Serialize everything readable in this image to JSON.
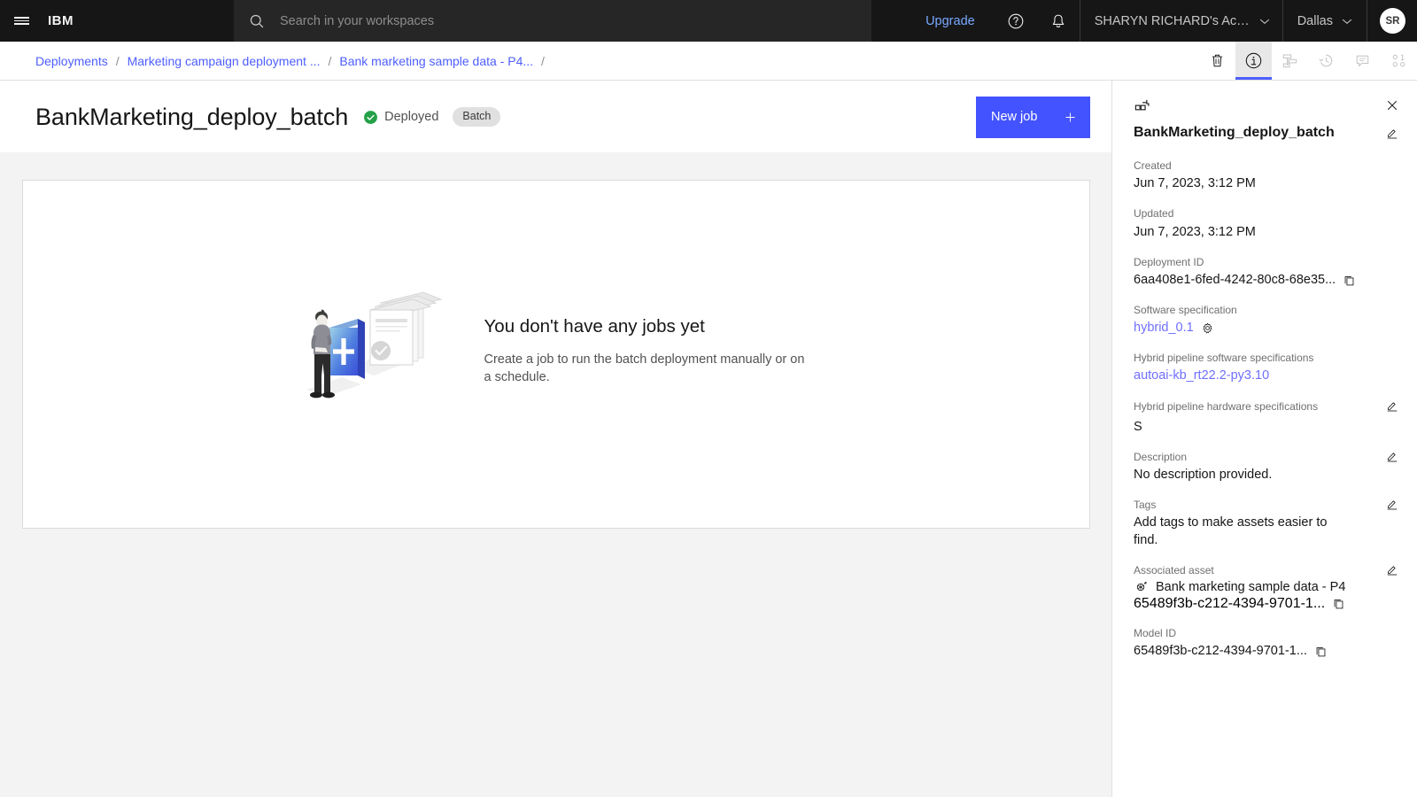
{
  "header": {
    "brand": "IBM",
    "menu_icon": "hamburger-icon",
    "search": {
      "placeholder": "Search in your workspaces",
      "value": "",
      "icon": "search-icon"
    },
    "upgrade_label": "Upgrade",
    "help_icon": "help-icon",
    "notifications_icon": "bell-icon",
    "account_name": "SHARYN RICHARD's Accou...",
    "region": "Dallas",
    "avatar_initials": "SR"
  },
  "breadcrumb": {
    "items": [
      {
        "label": "Deployments"
      },
      {
        "label": "Marketing campaign deployment ..."
      },
      {
        "label": "Bank marketing sample data - P4..."
      }
    ],
    "separator": "/",
    "trailing_separator": "/",
    "tools": [
      {
        "name": "delete-icon",
        "active": false
      },
      {
        "name": "info-icon",
        "active": true
      },
      {
        "name": "lineage-icon",
        "active": false
      },
      {
        "name": "history-icon",
        "active": false
      },
      {
        "name": "comments-icon",
        "active": false
      },
      {
        "name": "related-assets-icon",
        "active": false
      }
    ]
  },
  "page": {
    "title": "BankMarketing_deploy_batch",
    "status": "Deployed",
    "status_color": "#24a148",
    "tag": "Batch",
    "new_job_label": "New job",
    "accent_color": "#4353ff"
  },
  "empty_state": {
    "heading": "You don't have any jobs yet",
    "description": "Create a job to run the batch deployment manually or on a schedule.",
    "illustration": "no-jobs-illustration"
  },
  "details_panel": {
    "header_icon": "deployment-icon",
    "close_icon": "close-icon",
    "title": "BankMarketing_deploy_batch",
    "edit_icon": "edit-pencil-icon",
    "fields": {
      "created_label": "Created",
      "created_value": "Jun 7, 2023, 3:12 PM",
      "updated_label": "Updated",
      "updated_value": "Jun 7, 2023, 3:12 PM",
      "deployment_id_label": "Deployment ID",
      "deployment_id_value": "6aa408e1-6fed-4242-80c8-68e35...",
      "software_spec_label": "Software specification",
      "software_spec_value": "hybrid_0.1",
      "hybrid_sw_label": "Hybrid pipeline software specifications",
      "hybrid_sw_value": "autoai-kb_rt22.2-py3.10",
      "hybrid_hw_label": "Hybrid pipeline hardware specifications",
      "hybrid_hw_value": "S",
      "description_label": "Description",
      "description_value": "No description provided.",
      "tags_label": "Tags",
      "tags_value": "Add tags to make assets easier to find.",
      "associated_asset_label": "Associated asset",
      "associated_asset_value": "Bank marketing sample data - P4",
      "associated_asset_id": "65489f3b-c212-4394-9701-1...",
      "model_id_label": "Model ID",
      "model_id_value": "65489f3b-c212-4394-9701-1..."
    }
  }
}
